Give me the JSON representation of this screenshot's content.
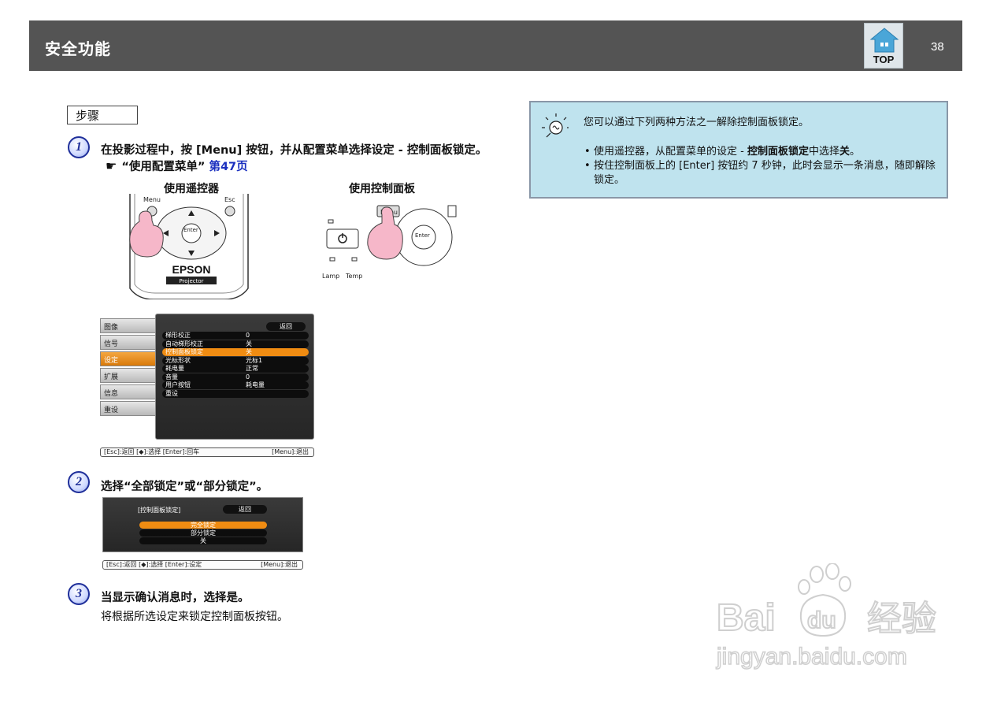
{
  "header": {
    "title": "安全功能",
    "top_badge_label": "TOP",
    "page_number": "38"
  },
  "steps_label": "步骤",
  "step1": {
    "number": "1",
    "text_a": "在投影过程中，按 [Menu] 按钮，并从配置菜单选择设定 - 控制面板锁定。",
    "hand": "☛",
    "ref_text": "“使用配置菜单”",
    "link_text": "第47页",
    "caption_remote": "使用遥控器",
    "caption_panel": "使用控制面板",
    "remote": {
      "menu_label": "Menu",
      "esc_label": "Esc",
      "enter_label": "Enter",
      "brand": "EPSON",
      "model": "Projector"
    },
    "panel": {
      "menu_label": "Menu",
      "enter_label": "Enter",
      "lamp_label": "Lamp",
      "temp_label": "Temp"
    },
    "menu_screen": {
      "left_items": [
        "图像",
        "信号",
        "设定",
        "扩展",
        "信息",
        "重设"
      ],
      "active_index": 2,
      "back_label": "返回",
      "rows": [
        {
          "label": "梯形校正",
          "value": "0"
        },
        {
          "label": "自动梯形校正",
          "value": "关"
        },
        {
          "label": "控制面板锁定",
          "value": "关"
        },
        {
          "label": "光标形状",
          "value": "光标1"
        },
        {
          "label": "耗电量",
          "value": "正常"
        },
        {
          "label": "音量",
          "value": "0"
        },
        {
          "label": "用户按钮",
          "value": "耗电量"
        },
        {
          "label": "重设",
          "value": ""
        }
      ],
      "highlighted_row": 2,
      "bar_left": "[Esc]:返回 [◆]:选择 [Enter]:回车",
      "bar_right": "[Menu]:退出"
    }
  },
  "step2": {
    "number": "2",
    "text": "选择“全部锁定”或“部分锁定”。",
    "screen": {
      "title": "[控制面板锁定]",
      "back_label": "返回",
      "options": [
        "完全锁定",
        "部分锁定",
        "关"
      ],
      "selected_index": 0,
      "bar_left": "[Esc]:返回 [◆]:选择 [Enter]:设定",
      "bar_right": "[Menu]:退出"
    }
  },
  "step3": {
    "number": "3",
    "text": "当显示确认消息时，选择是。",
    "sub": "将根据所选设定来锁定控制面板按钮。"
  },
  "tip": {
    "icon": "lightbulb-icon",
    "intro": "您可以通过下列两种方法之一解除控制面板锁定。",
    "item1_a": "使用遥控器，从配置菜单的设定 - ",
    "item1_b": "控制面板锁定",
    "item1_c": "中选择",
    "item1_d": "关",
    "item1_e": "。",
    "item2": "按住控制面板上的 [Enter] 按钮约 7 秒钟，此时会显示一条消息，随即解除锁定。"
  },
  "watermark": {
    "brand_a": "Bai",
    "brand_b": "du",
    "brand_c": "经验",
    "url": "jingyan.baidu.com"
  },
  "colors": {
    "header_bg": "#545454",
    "link": "#1a2fbf",
    "highlight": "#f08c12",
    "tip_bg": "#bfe3ee"
  }
}
